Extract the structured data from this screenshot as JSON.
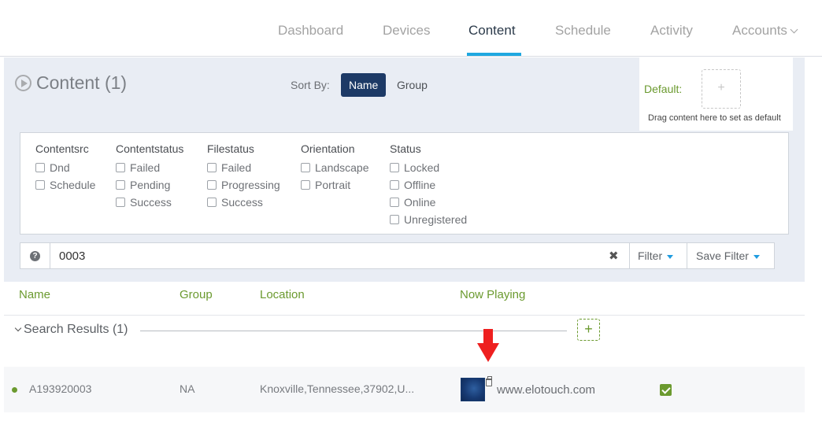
{
  "nav": {
    "items": [
      {
        "label": "Dashboard"
      },
      {
        "label": "Devices"
      },
      {
        "label": "Content"
      },
      {
        "label": "Schedule"
      },
      {
        "label": "Activity"
      },
      {
        "label": "Accounts"
      }
    ],
    "active": "Content"
  },
  "header": {
    "title": "Content (1)",
    "sort_label": "Sort By:",
    "sort_name": "Name",
    "sort_group": "Group",
    "default_label": "Default:",
    "default_drop_icon": "+",
    "default_hint": "Drag content here to set as default"
  },
  "filters": {
    "columns": [
      {
        "heading": "Contentsrc",
        "options": [
          "Dnd",
          "Schedule"
        ]
      },
      {
        "heading": "Contentstatus",
        "options": [
          "Failed",
          "Pending",
          "Success"
        ]
      },
      {
        "heading": "Filestatus",
        "options": [
          "Failed",
          "Progressing",
          "Success"
        ]
      },
      {
        "heading": "Orientation",
        "options": [
          "Landscape",
          "Portrait"
        ]
      },
      {
        "heading": "Status",
        "options": [
          "Locked",
          "Offline",
          "Online",
          "Unregistered"
        ]
      }
    ]
  },
  "search": {
    "help_icon": "?",
    "value": "0003",
    "clear_icon": "✖",
    "filter_label": "Filter",
    "save_filter_label": "Save Filter"
  },
  "table": {
    "headers": {
      "name": "Name",
      "group": "Group",
      "location": "Location",
      "now_playing": "Now Playing"
    },
    "group_label": "Search Results (1)",
    "add_icon": "+",
    "rows": [
      {
        "name": "A193920003",
        "group": "NA",
        "location": "Knoxville,Tennessee,37902,U...",
        "now_playing": "www.elotouch.com",
        "status_color": "#6b9a2f",
        "checked": true
      }
    ]
  },
  "colors": {
    "accent_green": "#6b9a2f",
    "nav_active_underline": "#1fa8e0",
    "sort_active": "#1d3a66",
    "annotation_arrow": "#ee1f1f"
  }
}
